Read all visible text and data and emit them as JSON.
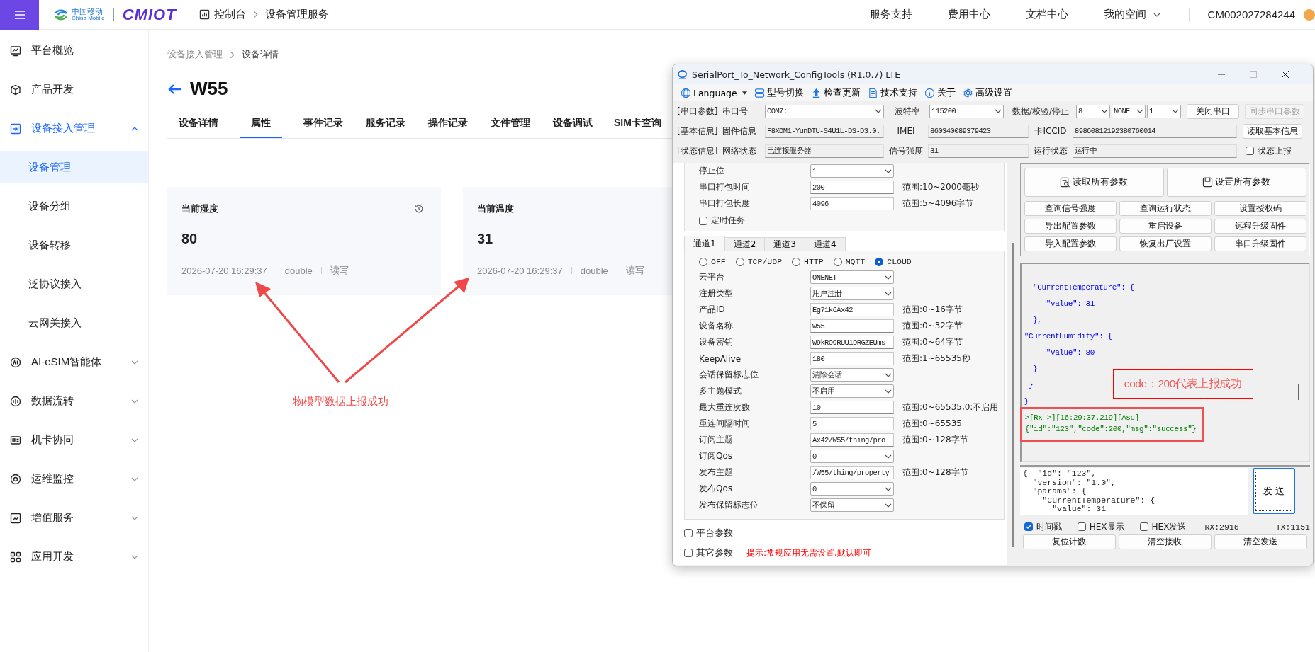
{
  "topbar": {
    "logo_cn": "中国移动",
    "logo_en": "China Mobile",
    "brand": "CMIOT",
    "breadcrumb": [
      "控制台",
      "设备管理服务"
    ],
    "nav": [
      {
        "label": "服务支持",
        "dropdown": false
      },
      {
        "label": "费用中心",
        "dropdown": false
      },
      {
        "label": "文档中心",
        "dropdown": false
      },
      {
        "label": "我的空间",
        "dropdown": true
      }
    ],
    "account": "CM002027284244"
  },
  "sidebar": [
    {
      "kind": "link",
      "label": "平台概览",
      "selected": false
    },
    {
      "kind": "link",
      "label": "产品开发",
      "selected": false
    },
    {
      "kind": "group",
      "label": "设备接入管理",
      "selected": true,
      "expanded": true,
      "children": [
        {
          "label": "设备管理",
          "selected": true
        },
        {
          "label": "设备分组",
          "selected": false
        },
        {
          "label": "设备转移",
          "selected": false
        },
        {
          "label": "泛协议接入",
          "selected": false
        },
        {
          "label": "云网关接入",
          "selected": false
        }
      ]
    },
    {
      "kind": "group",
      "label": "AI-eSIM智能体",
      "selected": false,
      "expanded": false
    },
    {
      "kind": "group",
      "label": "数据流转",
      "selected": false,
      "expanded": false
    },
    {
      "kind": "group",
      "label": "机卡协同",
      "selected": false,
      "expanded": false
    },
    {
      "kind": "group",
      "label": "运维监控",
      "selected": false,
      "expanded": false
    },
    {
      "kind": "group",
      "label": "增值服务",
      "selected": false,
      "expanded": false
    },
    {
      "kind": "group",
      "label": "应用开发",
      "selected": false,
      "expanded": false
    }
  ],
  "main": {
    "breadcrumb": [
      "设备接入管理",
      "设备详情"
    ],
    "title": "W55",
    "tabs": [
      {
        "label": "设备详情",
        "selected": false
      },
      {
        "label": "属性",
        "selected": true
      },
      {
        "label": "事件记录",
        "selected": false
      },
      {
        "label": "服务记录",
        "selected": false
      },
      {
        "label": "操作记录",
        "selected": false
      },
      {
        "label": "文件管理",
        "selected": false
      },
      {
        "label": "设备调试",
        "selected": false
      },
      {
        "label": "SIM卡查询",
        "selected": false
      }
    ],
    "cards": [
      {
        "title": "当前湿度",
        "value": "80",
        "time": "2026-07-20 16:29:37",
        "data_type": "double",
        "access": "读写",
        "history_icon": true
      },
      {
        "title": "当前温度",
        "value": "31",
        "time": "2026-07-20 16:29:37",
        "data_type": "double",
        "access": "读写"
      }
    ]
  },
  "config_tool": {
    "title": "SerialPort_To_Network_ConfigTools (R1.0.7) LTE",
    "toolbar": [
      {
        "kind": "language",
        "label": "Language"
      },
      {
        "kind": "switch",
        "label": "型号切换"
      },
      {
        "kind": "update",
        "label": "检查更新"
      },
      {
        "kind": "support",
        "label": "技术支持"
      },
      {
        "kind": "about",
        "label": "关于"
      },
      {
        "kind": "settings",
        "label": "高级设置"
      }
    ],
    "serial": {
      "section": "[串口参数]",
      "port_label": "串口号",
      "port": "COM7:",
      "baud_label": "波特率",
      "baud": "115200",
      "frame_label": "数据/校验/停止",
      "data_bits": "8",
      "parity": "NONE",
      "stop_bits": "1",
      "close_button": "关闭串口",
      "sync_button": {
        "label": "同步串口参数",
        "disabled": true
      }
    },
    "basic": {
      "section": "[基本信息]",
      "firmware_label": "固件信息",
      "firmware": "F8XOM1-YunDTU-S4U1L-DS-D3.0.",
      "imei_label": "IMEI",
      "imei": "860340089379423",
      "iccid_label": "卡ICCID",
      "iccid": "89860812192380760014",
      "read_button": "读取基本信息"
    },
    "status": {
      "section": "[状态信息]",
      "network_label": "网络状态",
      "network": "已连接服务器",
      "signal_label": "信号强度",
      "signal": "31",
      "run_label": "运行状态",
      "run": "运行中",
      "report": {
        "label": "状态上报",
        "checked": false
      }
    },
    "serial_settings": [
      {
        "kind": "select",
        "label": "停止位",
        "value": "1"
      },
      {
        "kind": "input",
        "label": "串口打包时间",
        "value": "200",
        "range": "范围:10~2000毫秒"
      },
      {
        "kind": "input",
        "label": "串口打包长度",
        "value": "4096",
        "range": "范围:5~4096字节"
      }
    ],
    "timer_task": {
      "label": "定时任务",
      "checked": false
    },
    "channel_tabs": [
      {
        "label": "通道1",
        "selected": true
      },
      {
        "label": "通道2",
        "selected": false
      },
      {
        "label": "通道3",
        "selected": false
      },
      {
        "label": "通道4",
        "selected": false
      }
    ],
    "modes": [
      {
        "label": "OFF",
        "selected": false
      },
      {
        "label": "TCP/UDP",
        "selected": false
      },
      {
        "label": "HTTP",
        "selected": false
      },
      {
        "label": "MQTT",
        "selected": false
      },
      {
        "label": "CLOUD",
        "selected": true
      }
    ],
    "channel_settings": [
      {
        "kind": "select",
        "label": "云平台",
        "value": "ONENET"
      },
      {
        "kind": "select",
        "label": "注册类型",
        "value": "用户注册"
      },
      {
        "kind": "input",
        "label": "产品ID",
        "value": "Eg71k6Ax42",
        "range": "范围:0~16字节"
      },
      {
        "kind": "input",
        "label": "设备名称",
        "value": "W55",
        "range": "范围:0~32字节"
      },
      {
        "kind": "input",
        "label": "设备密钥",
        "value": "W9kRO9RUU1DRGZEUms=",
        "range": "范围:0~64字节"
      },
      {
        "kind": "input",
        "label": "KeepAlive",
        "value": "180",
        "range": "范围:1~65535秒"
      },
      {
        "kind": "select",
        "label": "会话保留标志位",
        "value": "清除会话"
      },
      {
        "kind": "select",
        "label": "多主题模式",
        "value": "不启用"
      },
      {
        "kind": "input",
        "label": "最大重连次数",
        "value": "10",
        "range": "范围:0~65535,0:不启用"
      },
      {
        "kind": "input",
        "label": "重连间隔时间",
        "value": "5",
        "range": "范围:0~65535"
      },
      {
        "kind": "input",
        "label": "订阅主题",
        "value": "Ax42/W55/thing/pro",
        "range": "范围:0~128字节"
      },
      {
        "kind": "select",
        "label": "订阅Qos",
        "value": "0"
      },
      {
        "kind": "input",
        "label": "发布主题",
        "value": "/W55/thing/property",
        "range": "范围:0~128字节"
      },
      {
        "kind": "select",
        "label": "发布Qos",
        "value": "0"
      },
      {
        "kind": "select",
        "label": "发布保留标志位",
        "value": "不保留"
      }
    ],
    "extra_options": [
      {
        "label": "平台参数",
        "checked": false
      },
      {
        "label": "其它参数",
        "checked": false
      }
    ],
    "hint": "提示:常规应用无需设置,默认即可",
    "actions_main": [
      {
        "kind": "read",
        "label": "读取所有参数"
      },
      {
        "kind": "save",
        "label": "设置所有参数"
      }
    ],
    "actions": [
      "查询信号强度",
      "查询运行状态",
      "设置授权码",
      "导出配置参数",
      "重启设备",
      "远程升级固件",
      "导入配置参数",
      "恢复出厂设置",
      "串口升级固件"
    ],
    "receive_log": [
      {
        "kind": "json",
        "text": "  \"CurrentTemperature\": {",
        "highlighted": false
      },
      {
        "kind": "json",
        "text": "     \"value\": 31",
        "highlighted": false
      },
      {
        "kind": "json",
        "text": "  },",
        "highlighted": false
      },
      {
        "kind": "json",
        "text": "\"CurrentHumidity\": {",
        "highlighted": false
      },
      {
        "kind": "json",
        "text": "     \"value\": 80",
        "highlighted": false
      },
      {
        "kind": "json",
        "text": "  }",
        "highlighted": false
      },
      {
        "kind": "json",
        "text": " }",
        "highlighted": false
      },
      {
        "kind": "json",
        "text": "}",
        "highlighted": false
      },
      {
        "kind": "rx",
        "text": ">[Rx->][16:29:37.219][Asc]",
        "highlighted": true
      },
      {
        "kind": "rx",
        "text": "{\"id\":\"123\",\"code\":200,\"msg\":\"success\"}",
        "highlighted": true
      }
    ],
    "send_text": [
      "{  \"id\": \"123\",",
      "  \"version\": \"1.0\",",
      "  \"params\": {",
      "    \"CurrentTemperature\": {",
      "      \"value\": 31"
    ],
    "send_button": "发 送",
    "options": [
      {
        "label": "时间戳",
        "checked": true
      },
      {
        "label": "HEX显示",
        "checked": false
      },
      {
        "label": "HEX发送",
        "checked": false
      }
    ],
    "rx_count": "RX:2916",
    "tx_count": "TX:1151",
    "bottom_buttons": [
      "复位计数",
      "清空接收",
      "清空发送"
    ]
  },
  "annotations": {
    "arrow_label": "物模型数据上报成功",
    "callout": "code：200代表上报成功"
  }
}
